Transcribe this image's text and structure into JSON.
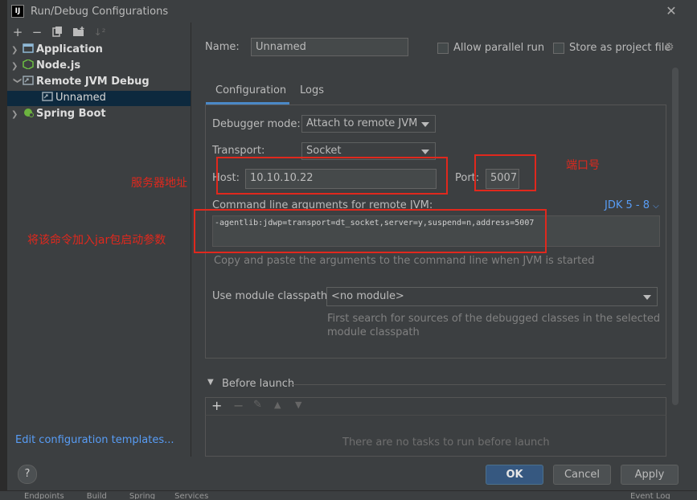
{
  "window": {
    "title": "Run/Debug Configurations"
  },
  "toolbar": {
    "add": "+",
    "remove": "−",
    "sort": "↓²"
  },
  "tree": {
    "items": [
      {
        "label": "Application",
        "bold": true
      },
      {
        "label": "Node.js",
        "bold": true
      },
      {
        "label": "Remote JVM Debug",
        "bold": true
      },
      {
        "label": "Unnamed",
        "bold": false
      },
      {
        "label": "Spring Boot",
        "bold": true
      }
    ],
    "edit_templates": "Edit configuration templates..."
  },
  "form": {
    "name_label": "Name:",
    "name_value": "Unnamed",
    "allow_parallel": "Allow parallel run",
    "store_project": "Store as project file",
    "tabs": [
      {
        "label": "Configuration"
      },
      {
        "label": "Logs"
      }
    ],
    "debugger_mode_label": "Debugger mode:",
    "debugger_mode_value": "Attach to remote JVM",
    "transport_label": "Transport:",
    "transport_value": "Socket",
    "host_label": "Host:",
    "host_value": "10.10.10.22",
    "port_label": "Port:",
    "port_value": "5007",
    "cmdline_label": "Command line arguments for remote JVM:",
    "jdk_link": "JDK 5 - 8",
    "cmdline_value": "-agentlib:jdwp=transport=dt_socket,server=y,suspend=n,address=5007",
    "cmdline_hint": "Copy and paste the arguments to the command line when JVM is started",
    "module_label": "Use module classpath:",
    "module_value": "<no module>",
    "module_hint_1": "First search for sources of the debugged classes in the selected",
    "module_hint_2": "module classpath",
    "before_launch": "Before launch",
    "no_tasks": "There are no tasks to run before launch"
  },
  "annotations": {
    "server_address": "服务器地址",
    "port_number": "端口号",
    "add_to_jar": "将该命令加入jar包启动参数"
  },
  "buttons": {
    "help": "?",
    "ok": "OK",
    "cancel": "Cancel",
    "apply": "Apply"
  },
  "statusbar": {
    "items": [
      "Endpoints",
      "Build",
      "Spring",
      "Services"
    ],
    "event_log": "Event Log"
  },
  "colors": {
    "accent": "#4a88c7",
    "annotation_red": "#e0281d",
    "selection": "#0d293e",
    "link": "#589df6"
  }
}
